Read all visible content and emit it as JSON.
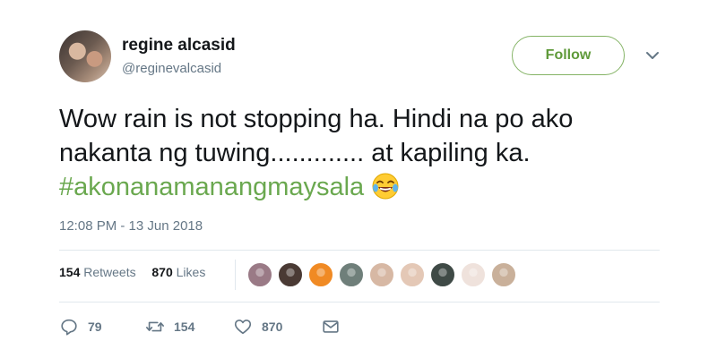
{
  "user": {
    "name": "regine alcasid",
    "handle": "@reginevalcasid"
  },
  "follow_label": "Follow",
  "tweet": {
    "line1": "Wow rain is not stopping ha. Hindi na po ako",
    "line2": "nakanta ng tuwing............. at kapiling ka.",
    "hashtag": "#akonanamanangmaysala",
    "emoji": "face-with-tears-of-joy"
  },
  "timestamp": "12:08 PM - 13 Jun 2018",
  "stats": {
    "retweets_count": "154",
    "retweets_label": "Retweets",
    "likes_count": "870",
    "likes_label": "Likes"
  },
  "liker_avatar_colors": [
    "#9a7a86",
    "#4a3a34",
    "#f08a24",
    "#6f7f7a",
    "#d7b8a4",
    "#e4c8b6",
    "#3f4a46",
    "#efe2dc",
    "#c9b09a"
  ],
  "actions": {
    "reply_count": "79",
    "retweet_count": "154",
    "like_count": "870"
  },
  "colors": {
    "accent_green": "#6aa84f",
    "text_secondary": "#657786",
    "divider": "#e1e8ed"
  }
}
